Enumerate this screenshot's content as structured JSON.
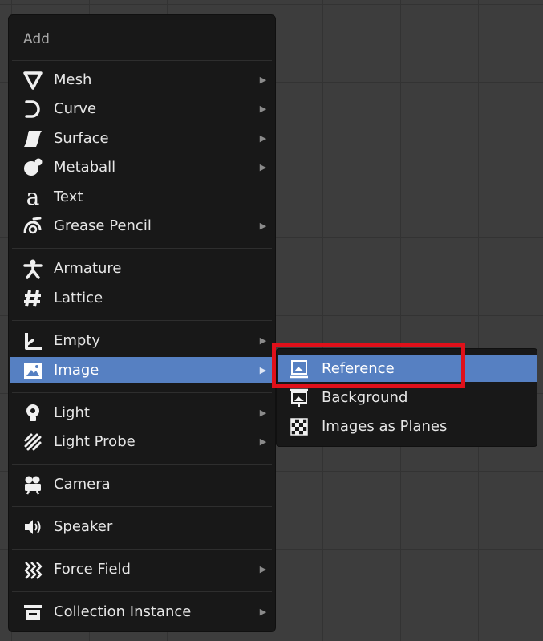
{
  "menu": {
    "title": "Add",
    "items": [
      {
        "label": "Mesh",
        "icon": "mesh-icon",
        "submenu": true
      },
      {
        "label": "Curve",
        "icon": "curve-icon",
        "submenu": true
      },
      {
        "label": "Surface",
        "icon": "surface-icon",
        "submenu": true
      },
      {
        "label": "Metaball",
        "icon": "metaball-icon",
        "submenu": true
      },
      {
        "label": "Text",
        "icon": "text-icon",
        "submenu": false
      },
      {
        "label": "Grease Pencil",
        "icon": "grease-pencil-icon",
        "submenu": true
      },
      {
        "label": "Armature",
        "icon": "armature-icon",
        "submenu": false
      },
      {
        "label": "Lattice",
        "icon": "lattice-icon",
        "submenu": false
      },
      {
        "label": "Empty",
        "icon": "empty-icon",
        "submenu": true
      },
      {
        "label": "Image",
        "icon": "image-icon",
        "submenu": true,
        "highlighted": true
      },
      {
        "label": "Light",
        "icon": "light-icon",
        "submenu": true
      },
      {
        "label": "Light Probe",
        "icon": "light-probe-icon",
        "submenu": true
      },
      {
        "label": "Camera",
        "icon": "camera-icon",
        "submenu": false
      },
      {
        "label": "Speaker",
        "icon": "speaker-icon",
        "submenu": false
      },
      {
        "label": "Force Field",
        "icon": "force-field-icon",
        "submenu": true
      },
      {
        "label": "Collection Instance",
        "icon": "collection-instance-icon",
        "submenu": true
      }
    ]
  },
  "image_submenu": {
    "items": [
      {
        "label": "Reference",
        "icon": "reference-image-icon",
        "highlighted": true
      },
      {
        "label": "Background",
        "icon": "background-image-icon"
      },
      {
        "label": "Images as Planes",
        "icon": "checkerboard-icon"
      }
    ]
  },
  "colors": {
    "highlight": "#5680c2",
    "menu_background": "#181818",
    "annotation_box": "#e0101a"
  },
  "submenu_arrow_glyph": "▶"
}
